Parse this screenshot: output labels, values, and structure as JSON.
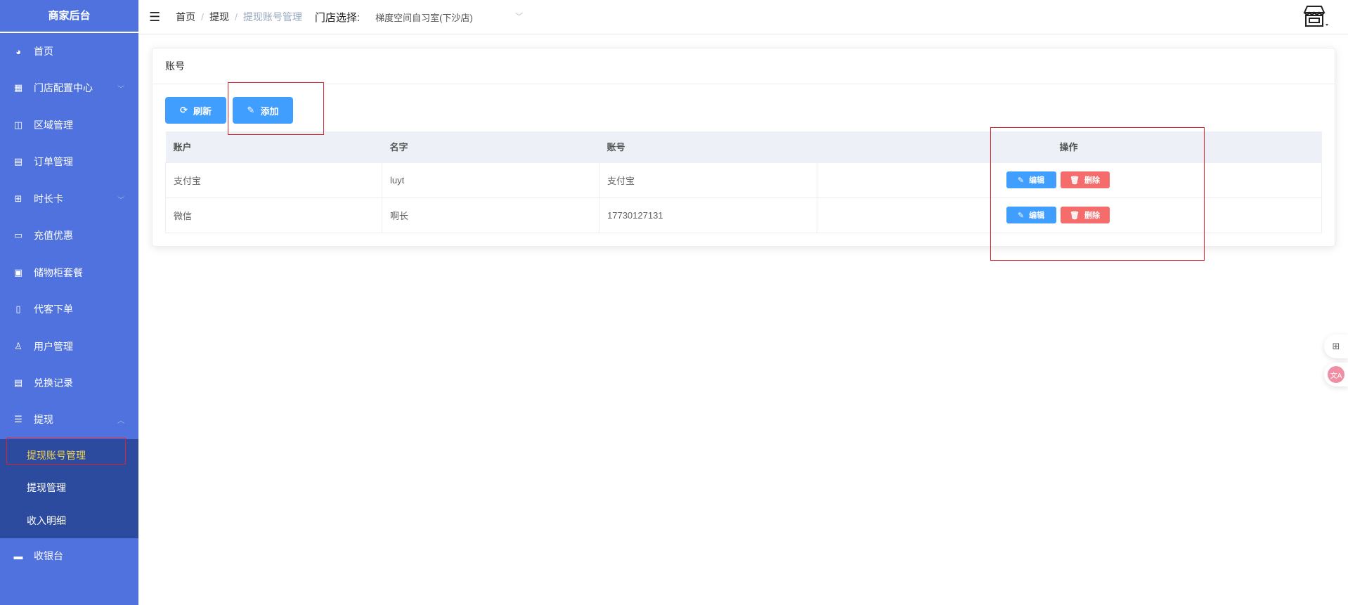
{
  "sidebar": {
    "title": "商家后台",
    "items": [
      {
        "label": "首页",
        "icon": "dashboard-icon",
        "glyph": "◕"
      },
      {
        "label": "门店配置中心",
        "icon": "grid-icon",
        "glyph": "▦",
        "arrow": "﹀"
      },
      {
        "label": "区域管理",
        "icon": "book-icon",
        "glyph": "◫"
      },
      {
        "label": "订单管理",
        "icon": "document-icon",
        "glyph": "▤"
      },
      {
        "label": "时长卡",
        "icon": "gift-icon",
        "glyph": "⊞",
        "arrow": "﹀"
      },
      {
        "label": "充值优惠",
        "icon": "wallet-icon",
        "glyph": "▭"
      },
      {
        "label": "储物柜套餐",
        "icon": "locker-icon",
        "glyph": "▣"
      },
      {
        "label": "代客下单",
        "icon": "clipboard-icon",
        "glyph": "▯"
      },
      {
        "label": "用户管理",
        "icon": "user-icon",
        "glyph": "♙"
      },
      {
        "label": "兑换记录",
        "icon": "list-icon",
        "glyph": "▤"
      },
      {
        "label": "提现",
        "icon": "sliders-icon",
        "glyph": "☰",
        "arrow": "︿"
      },
      {
        "label": "收银台",
        "icon": "monitor-icon",
        "glyph": "▬"
      }
    ],
    "submenu": [
      "提现账号管理",
      "提现管理",
      "收入明细"
    ]
  },
  "header": {
    "breadcrumb": [
      "首页",
      "提现",
      "提现账号管理"
    ],
    "store_label": "门店选择:",
    "store_value": "梯度空间自习室(下沙店)"
  },
  "card": {
    "title": "账号",
    "refresh": "刷新",
    "add": "添加"
  },
  "table": {
    "columns": [
      "账户",
      "名字",
      "账号",
      "",
      "操作"
    ],
    "rows": [
      [
        "支付宝",
        "luyt",
        "支付宝"
      ],
      [
        "微信",
        "啊长",
        "17730127131"
      ]
    ],
    "edit": "编辑",
    "delete": "删除"
  },
  "colors": {
    "sidebar": "#4f72de",
    "submenu": "#2d4b9e",
    "active": "#f0d050",
    "primary": "#409eff",
    "danger": "#f56c6c"
  }
}
